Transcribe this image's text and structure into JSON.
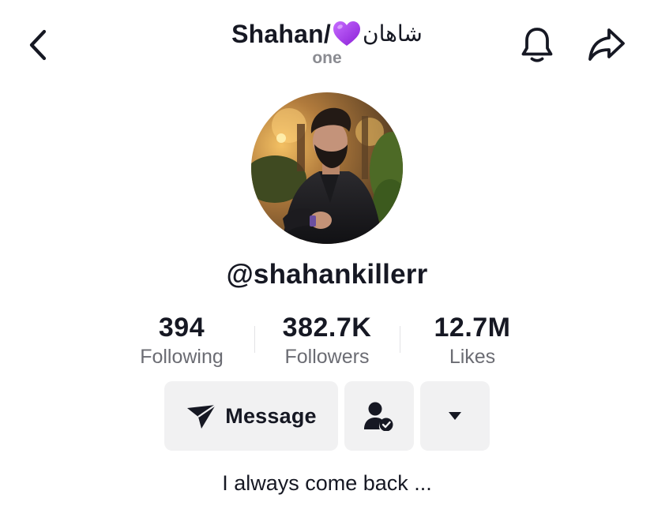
{
  "header": {
    "name": "Shahan/",
    "name_arabic": "شاهان",
    "heart_emoji": "purple-heart",
    "subtitle": "one",
    "icons": {
      "back": "chevron-left-icon",
      "notifications": "bell-icon",
      "share": "share-arrow-icon"
    }
  },
  "profile": {
    "avatar": "profile-photo",
    "handle": "@shahankillerr"
  },
  "stats": [
    {
      "value": "394",
      "label": "Following"
    },
    {
      "value": "382.7K",
      "label": "Followers"
    },
    {
      "value": "12.7M",
      "label": "Likes"
    }
  ],
  "actions": {
    "message_label": "Message",
    "message_icon": "send-plane-icon",
    "following_icon": "person-check-icon",
    "more_icon": "caret-down-icon"
  },
  "bio": "I always come back ...",
  "colors": {
    "text": "#161823",
    "muted": "#8a8b91",
    "button_bg": "#f1f1f2",
    "heart": "#a020f0"
  }
}
